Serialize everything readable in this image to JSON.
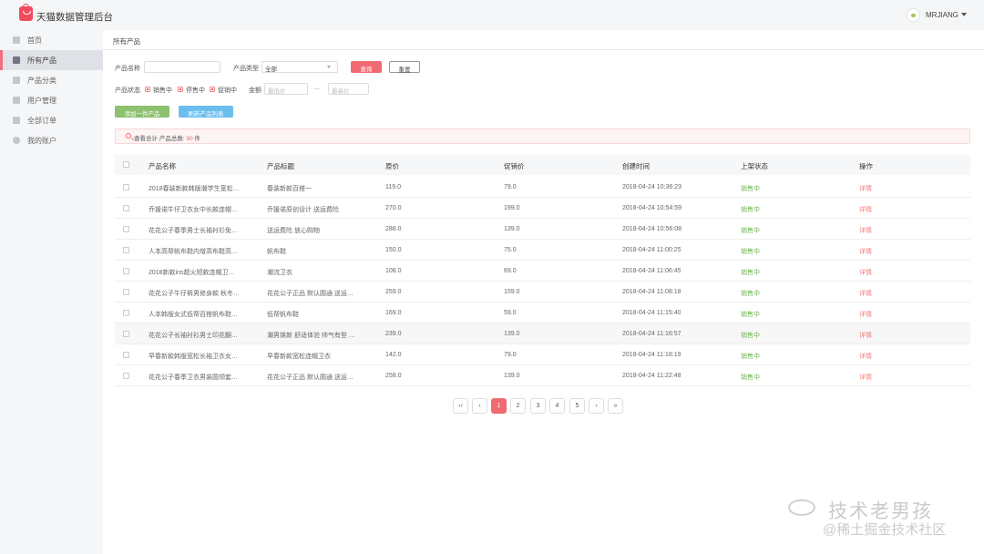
{
  "app": {
    "title": "天猫数据管理后台",
    "username": "MRJIANG"
  },
  "sidebar": {
    "items": [
      {
        "label": "首页",
        "icon": "home-icon"
      },
      {
        "label": "所有产品",
        "icon": "box-icon",
        "active": true
      },
      {
        "label": "产品分类",
        "icon": "grid-icon"
      },
      {
        "label": "用户管理",
        "icon": "user-icon"
      },
      {
        "label": "全部订单",
        "icon": "order-icon"
      },
      {
        "label": "我的账户",
        "icon": "gear-icon"
      }
    ]
  },
  "breadcrumb": "所有产品",
  "filters": {
    "name_label": "产品名称",
    "name_value": "",
    "type_label": "产品类型",
    "type_value": "全部",
    "search_button": "查询",
    "reset_button": "重置",
    "status_label": "产品状态",
    "status_options": [
      "销售中",
      "停售中",
      "促销中"
    ],
    "amount_label": "金额",
    "min_placeholder": "最低价",
    "range_separator": "—",
    "max_placeholder": "最高价"
  },
  "actions": {
    "add_button": "添加一件产品",
    "refresh_button": "刷新产品列表"
  },
  "summary": {
    "prefix": "查看合计",
    "count_label": "产品总数:",
    "count": "90",
    "unit": "件"
  },
  "table": {
    "columns": [
      "产品名称",
      "产品标题",
      "原价",
      "促销价",
      "创建时间",
      "上架状态",
      "操作"
    ],
    "rows": [
      [
        "2018春装新款韩版潮学生宽松…",
        "春装新款百搭一",
        "119.0",
        "79.0",
        "2018-04-24 10:36:23",
        "销售中",
        "详情"
      ],
      [
        "乔援诺牛仔卫衣女中长款连帽…",
        "乔援诺原创设计 送运费险",
        "270.0",
        "199.0",
        "2018-04-24 10:54:59",
        "销售中",
        "详情"
      ],
      [
        "花花公子春季男士长袖衬衫免…",
        "送运费险 放心购物",
        "288.0",
        "139.0",
        "2018-04-24 10:56:08",
        "销售中",
        "详情"
      ],
      [
        "人本高帮帆布鞋内增高布鞋高…",
        "帆布鞋",
        "150.0",
        "75.0",
        "2018-04-24 11:00:25",
        "销售中",
        "详情"
      ],
      [
        "2018新款ins超火短款连帽卫…",
        "潮流卫衣",
        "108.0",
        "69.0",
        "2018-04-24 11:06:45",
        "销售中",
        "详情"
      ],
      [
        "花花公子牛仔裤男修身款 秋冬…",
        "花花公子正品 默认圆通 送运…",
        "259.0",
        "159.0",
        "2018-04-24 11:08:18",
        "销售中",
        "详情"
      ],
      [
        "人本韩版女式低帮百搭帆布鞋…",
        "低帮帆布鞋",
        "169.0",
        "59.0",
        "2018-04-24 11:15:40",
        "销售中",
        "详情"
      ],
      [
        "花花公子长袖衬衫男士印花翻…",
        "潮男焕新 舒适体验 帅气有型 …",
        "239.0",
        "139.0",
        "2018-04-24 11:16:57",
        "销售中",
        "详情"
      ],
      [
        "早春新款韩版宽松长袖卫衣女…",
        "早春新款宽松连帽卫衣",
        "142.0",
        "79.0",
        "2018-04-24 11:18:19",
        "销售中",
        "详情"
      ],
      [
        "花花公子春季卫衣男装圆领套…",
        "花花公子正品 默认圆通 送运…",
        "258.0",
        "139.0",
        "2018-04-24 11:22:48",
        "销售中",
        "详情"
      ]
    ]
  },
  "pagination": {
    "first": "‹‹",
    "prev": "‹",
    "pages": [
      "1",
      "2",
      "3",
      "4",
      "5"
    ],
    "current": "1",
    "next": "›",
    "last": "»"
  },
  "watermark": {
    "title": "技术老男孩",
    "subtitle": "@稀土掘金技术社区"
  },
  "colors": {
    "accent": "#f06a72",
    "status_on_sale": "#70b451",
    "add_button": "#8dc16f",
    "refresh_button": "#6bbdee"
  }
}
